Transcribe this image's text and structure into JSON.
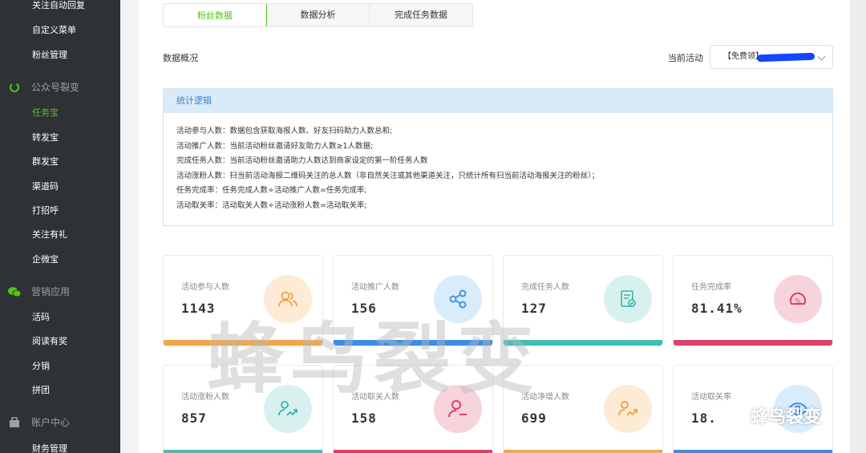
{
  "sidebar": {
    "top_items": [
      {
        "label": "关注自动回复"
      },
      {
        "label": "自定义菜单"
      },
      {
        "label": "粉丝管理"
      }
    ],
    "groups": [
      {
        "label": "公众号裂变",
        "icon": "swirl-icon",
        "items": [
          {
            "label": "任务宝",
            "active": true
          },
          {
            "label": "转发宝"
          },
          {
            "label": "群发宝"
          },
          {
            "label": "渠道码"
          },
          {
            "label": "打招呼"
          },
          {
            "label": "关注有礼"
          },
          {
            "label": "企微宝"
          }
        ]
      },
      {
        "label": "营销应用",
        "icon": "chat-icon",
        "items": [
          {
            "label": "活码"
          },
          {
            "label": "阅读有奖"
          },
          {
            "label": "分销"
          },
          {
            "label": "拼团"
          }
        ]
      },
      {
        "label": "账户中心",
        "icon": "account-icon",
        "items": [
          {
            "label": "财务管理"
          }
        ]
      }
    ]
  },
  "tabs": [
    {
      "label": "粉丝数据",
      "active": true
    },
    {
      "label": "数据分析"
    },
    {
      "label": "完成任务数据"
    }
  ],
  "overview_label": "数据概况",
  "activity": {
    "label": "当前活动",
    "selected_value": "【免费领】"
  },
  "logic": {
    "title": "统计逻辑",
    "lines": [
      "活动参与人数：数据包含获取海报人数、好友扫码助力人数总和;",
      "活动推广人数：当前活动粉丝邀请好友助力人数≥1人数据;",
      "完成任务人数：当前活动粉丝邀请助力人数达到商家设定的第一阶任务人数",
      "活动涨粉人数：扫当前活动海报二维码关注的总人数（非自然关注或其他渠道关注，只统计所有扫当前活动海报关注的粉丝）；",
      "任务完成率：任务完成人数÷活动推广人数=任务完成率;",
      "活动取关率：活动取关人数÷活动涨粉人数=活动取关率;"
    ]
  },
  "cards": [
    {
      "label": "活动参与人数",
      "value": "1143",
      "icon": "users-icon",
      "icon_bg": "#fdebd6",
      "icon_color": "#f0a040",
      "bar": "#f0a84a"
    },
    {
      "label": "活动推广人数",
      "value": "156",
      "icon": "share-icon",
      "icon_bg": "#d9ecfb",
      "icon_color": "#3e95e8",
      "bar": "#3a8ee6"
    },
    {
      "label": "完成任务人数",
      "value": "127",
      "icon": "task-doc-icon",
      "icon_bg": "#d8f1ef",
      "icon_color": "#3ab3aa",
      "bar": "#45bdb5"
    },
    {
      "label": "任务完成率",
      "value": "81.41%",
      "icon": "gauge-icon",
      "icon_bg": "#f7d3dc",
      "icon_color": "#d9416a",
      "bar": "#d9416a"
    },
    {
      "label": "活动涨粉人数",
      "value": "857",
      "icon": "trend-user-icon",
      "icon_bg": "#d8f1ef",
      "icon_color": "#3ab3aa",
      "bar": "#45bdb5"
    },
    {
      "label": "活动取关人数",
      "value": "158",
      "icon": "user-minus-icon",
      "icon_bg": "#f7d3dc",
      "icon_color": "#d9416a",
      "bar": "#d9416a"
    },
    {
      "label": "活动净增人数",
      "value": "699",
      "icon": "trend-user-icon",
      "icon_bg": "#fdebd6",
      "icon_color": "#f0a040",
      "bar": "#f0a84a"
    },
    {
      "label": "活动取关率",
      "value": "18.",
      "icon": "eye-icon",
      "icon_bg": "#d9ecfb",
      "icon_color": "#3e95e8",
      "bar": "#3a8ee6"
    }
  ],
  "watermark": "蜂鸟裂变",
  "brand": "蜂鸟裂变",
  "colors": {
    "accent": "#52c41a",
    "sidebar_bg": "#2f3234",
    "logic_head_bg": "#dbeaf7"
  }
}
